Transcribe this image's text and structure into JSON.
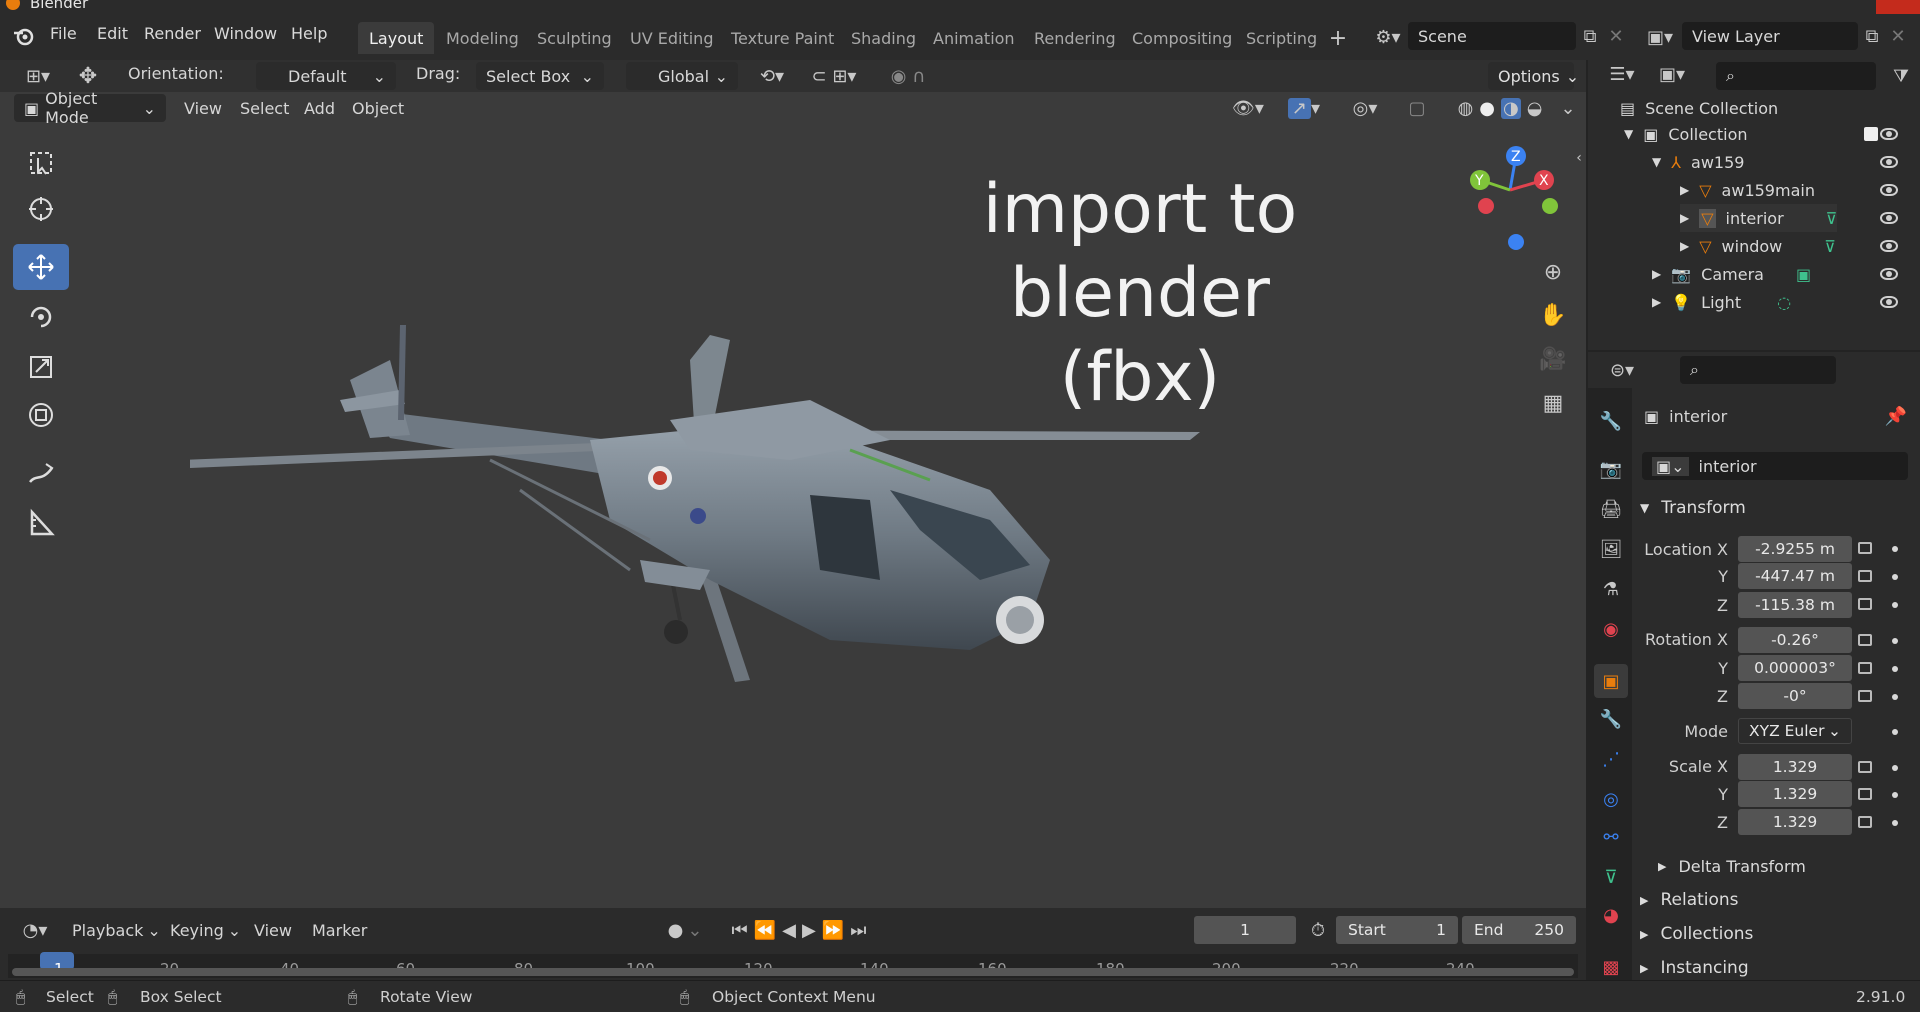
{
  "window": {
    "title": "Blender"
  },
  "menu": [
    "File",
    "Edit",
    "Render",
    "Window",
    "Help"
  ],
  "workspaces": [
    "Layout",
    "Modeling",
    "Sculpting",
    "UV Editing",
    "Texture Paint",
    "Shading",
    "Animation",
    "Rendering",
    "Compositing",
    "Scripting"
  ],
  "active_workspace": "Layout",
  "scene": {
    "label": "Scene"
  },
  "view_layer": {
    "label": "View Layer"
  },
  "tool_header": {
    "orientation_label": "Orientation:",
    "orientation_value": "Default",
    "drag_label": "Drag:",
    "drag_value": "Select Box",
    "transform_orientation": "Global",
    "options_label": "Options"
  },
  "viewport_header": {
    "mode": "Object Mode",
    "menus": [
      "View",
      "Select",
      "Add",
      "Object"
    ]
  },
  "overlay": {
    "line1": "import to blender",
    "line2": "(fbx)"
  },
  "outliner": {
    "items": [
      {
        "label": "Scene Collection"
      },
      {
        "label": "Collection"
      },
      {
        "label": "aw159"
      },
      {
        "label": "aw159main"
      },
      {
        "label": "interior"
      },
      {
        "label": "window"
      },
      {
        "label": "Camera"
      },
      {
        "label": "Light"
      }
    ]
  },
  "properties": {
    "object_name": "interior",
    "data_name": "interior",
    "transform_label": "Transform",
    "location_label": "Location X",
    "loc_y_label": "Y",
    "loc_z_label": "Z",
    "location": {
      "x": "-2.9255 m",
      "y": "-447.47 m",
      "z": "-115.38 m"
    },
    "rotation_label": "Rotation X",
    "rot_y_label": "Y",
    "rot_z_label": "Z",
    "rotation": {
      "x": "-0.26°",
      "y": "0.000003°",
      "z": "-0°"
    },
    "mode_label": "Mode",
    "mode_value": "XYZ Euler",
    "scale_label": "Scale X",
    "scale_y_label": "Y",
    "scale_z_label": "Z",
    "scale": {
      "x": "1.329",
      "y": "1.329",
      "z": "1.329"
    },
    "delta_transform": "Delta Transform",
    "relations": "Relations",
    "collections": "Collections",
    "instancing": "Instancing"
  },
  "timeline": {
    "menus": [
      "Playback",
      "Keying",
      "View",
      "Marker"
    ],
    "current_frame": "1",
    "start_label": "Start",
    "start": "1",
    "end_label": "End",
    "end": "250",
    "ticks": [
      "1",
      "20",
      "40",
      "60",
      "80",
      "100",
      "120",
      "140",
      "160",
      "180",
      "200",
      "220",
      "240"
    ]
  },
  "statusbar": {
    "select": "Select",
    "box_select": "Box Select",
    "rotate_view": "Rotate View",
    "context_menu": "Object Context Menu",
    "version": "2.91.0"
  },
  "colors": {
    "accent": "#4772b3",
    "active_tool": "#4772b3",
    "orange": "#e87d0d",
    "gizmo_x": "#e0434f",
    "gizmo_y": "#80c43a",
    "gizmo_z": "#3b82f2"
  }
}
